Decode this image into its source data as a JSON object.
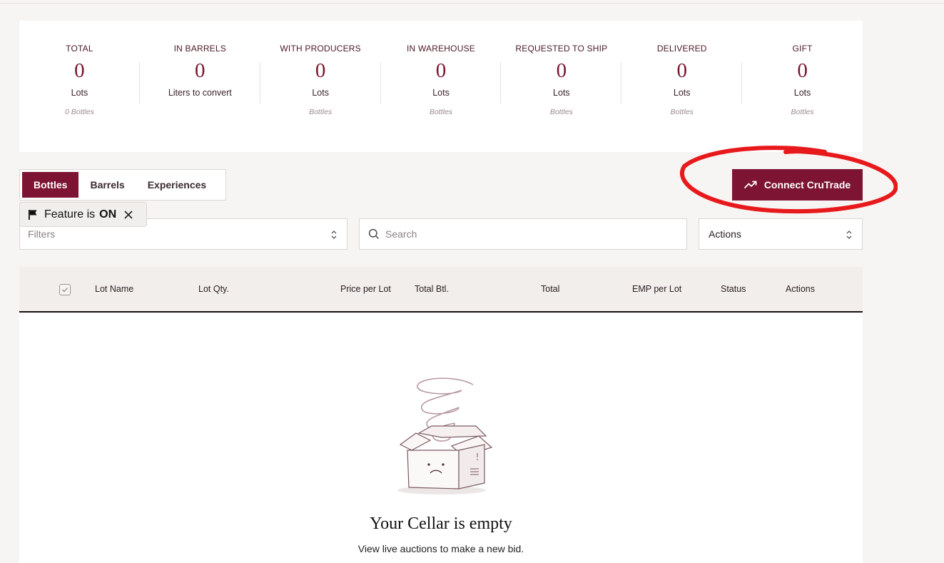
{
  "stats": [
    {
      "label": "TOTAL",
      "value": "0",
      "unit": "Lots",
      "sub": "0 Bottles"
    },
    {
      "label": "IN BARRELS",
      "value": "0",
      "unit": "Liters to convert",
      "sub": ""
    },
    {
      "label": "WITH PRODUCERS",
      "value": "0",
      "unit": "Lots",
      "sub": "Bottles"
    },
    {
      "label": "IN WAREHOUSE",
      "value": "0",
      "unit": "Lots",
      "sub": "Bottles"
    },
    {
      "label": "REQUESTED TO SHIP",
      "value": "0",
      "unit": "Lots",
      "sub": "Bottles"
    },
    {
      "label": "DELIVERED",
      "value": "0",
      "unit": "Lots",
      "sub": "Bottles"
    },
    {
      "label": "GIFT",
      "value": "0",
      "unit": "Lots",
      "sub": "Bottles"
    }
  ],
  "tabs": [
    "Bottles",
    "Barrels",
    "Experiences"
  ],
  "active_tab": "Bottles",
  "feature_flag": {
    "text": "Feature is",
    "state": "ON"
  },
  "connect_button": {
    "label": "Connect CruTrade"
  },
  "filters": {
    "placeholder": "Filters"
  },
  "search": {
    "placeholder": "Search"
  },
  "actions_select": {
    "label": "Actions"
  },
  "table": {
    "columns": [
      "Lot Name",
      "Lot Qty.",
      "Price per Lot",
      "Total Btl.",
      "Total",
      "EMP per Lot",
      "Status",
      "Actions"
    ]
  },
  "empty_state": {
    "title": "Your Cellar is empty",
    "subtitle": "View live auctions to make a new bid."
  },
  "colors": {
    "brand": "#7d1434",
    "annotation": "#e8191c",
    "background": "#f7f5f3"
  }
}
